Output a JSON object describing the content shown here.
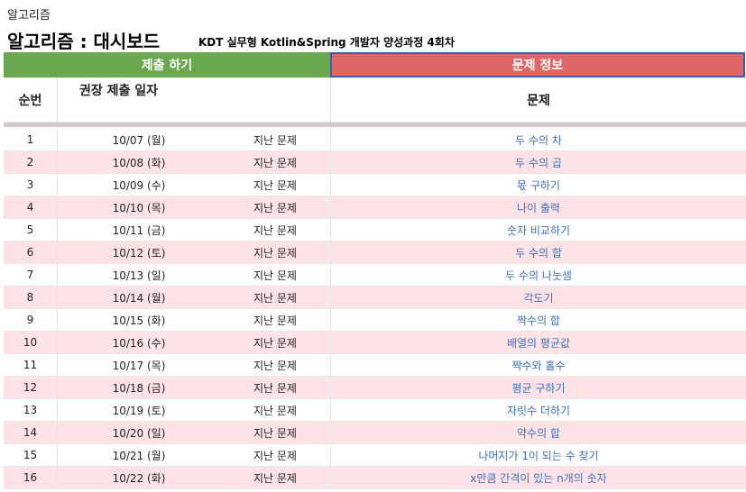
{
  "sheet_label": "알고리즘",
  "title": "알고리즘 : 대시보드",
  "subtitle": "KDT 실무형 Kotlin&Spring 개발자 양성과정 4회차",
  "band_submit": "제출 하기",
  "band_info": "문제 정보",
  "headers": {
    "number": "순번",
    "date": "권장 제출 일자",
    "problem": "문제"
  },
  "colors": {
    "submit_band": "#6aa84f",
    "info_band": "#e06666",
    "alt_row": "#fde3e6",
    "link": "#3a6fc4"
  },
  "rows": [
    {
      "num": "1",
      "date": "10/07 (월)",
      "status": "지난 문제",
      "problem": "두 수의 차"
    },
    {
      "num": "2",
      "date": "10/08 (화)",
      "status": "지난 문제",
      "problem": "두 수의 곱"
    },
    {
      "num": "3",
      "date": "10/09 (수)",
      "status": "지난 문제",
      "problem": "몫 구하기"
    },
    {
      "num": "4",
      "date": "10/10 (목)",
      "status": "지난 문제",
      "problem": "나이 출력"
    },
    {
      "num": "5",
      "date": "10/11 (금)",
      "status": "지난 문제",
      "problem": "숫자 비교하기"
    },
    {
      "num": "6",
      "date": "10/12 (토)",
      "status": "지난 문제",
      "problem": "두 수의 합"
    },
    {
      "num": "7",
      "date": "10/13 (일)",
      "status": "지난 문제",
      "problem": "두 수의 나눗셈"
    },
    {
      "num": "8",
      "date": "10/14 (월)",
      "status": "지난 문제",
      "problem": "각도기"
    },
    {
      "num": "9",
      "date": "10/15 (화)",
      "status": "지난 문제",
      "problem": "짝수의 합"
    },
    {
      "num": "10",
      "date": "10/16 (수)",
      "status": "지난 문제",
      "problem": "배열의 평균값"
    },
    {
      "num": "11",
      "date": "10/17 (목)",
      "status": "지난 문제",
      "problem": "짝수와 홀수"
    },
    {
      "num": "12",
      "date": "10/18 (금)",
      "status": "지난 문제",
      "problem": "평균 구하기"
    },
    {
      "num": "13",
      "date": "10/19 (토)",
      "status": "지난 문제",
      "problem": "자릿수 더하기"
    },
    {
      "num": "14",
      "date": "10/20 (일)",
      "status": "지난 문제",
      "problem": "약수의 합"
    },
    {
      "num": "15",
      "date": "10/21 (월)",
      "status": "지난 문제",
      "problem": "나머지가 1이 되는 수 찾기"
    },
    {
      "num": "16",
      "date": "10/22 (화)",
      "status": "지난 문제",
      "problem": "x만큼 간격이 있는 n개의 숫자"
    }
  ]
}
